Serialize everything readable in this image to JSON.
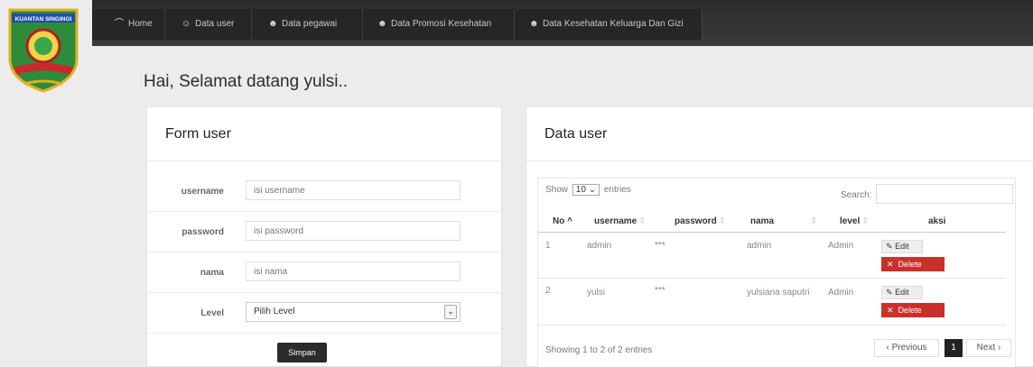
{
  "logo": {
    "text": "KUANTAN SINGINGI"
  },
  "nav": {
    "items": [
      {
        "icon": "dashboard-icon",
        "glyph": "⌒",
        "label": "Home"
      },
      {
        "icon": "user-icon",
        "glyph": "👤",
        "label": "Data user"
      },
      {
        "icon": "users-icon",
        "glyph": "👥",
        "label": "Data pegawai"
      },
      {
        "icon": "users-icon",
        "glyph": "👥",
        "label": "Data Promosi Kesehatan"
      },
      {
        "icon": "users-icon",
        "glyph": "👥",
        "label": "Data Kesehatan Keluarga Dan Gizi"
      }
    ]
  },
  "greeting": "Hai, Selamat datang yulsi..",
  "form": {
    "title": "Form user",
    "fields": [
      {
        "label": "username",
        "placeholder": "isi username"
      },
      {
        "label": "password",
        "placeholder": "isi password"
      },
      {
        "label": "nama",
        "placeholder": "isi nama"
      }
    ],
    "level_label": "Level",
    "level_selected": "Pilih Level",
    "submit": "Simpan"
  },
  "datatable": {
    "title": "Data user",
    "show": "Show",
    "length": "10",
    "entries": "entries",
    "search_label": "Search:",
    "headers": [
      "No",
      "username",
      "password",
      "nama",
      "level",
      "aksi"
    ],
    "rows": [
      {
        "no": "1",
        "username": "admin",
        "password": "***",
        "nama": "admin",
        "level": "Admin"
      },
      {
        "no": "2",
        "username": "yulsi",
        "password": "***",
        "nama": "yulsiana saputri",
        "level": "Admin"
      }
    ],
    "edit_label": "Edit",
    "delete_label": "Delete",
    "info": "Showing 1 to 2 of 2 entries",
    "prev": "‹ Previous",
    "page": "1",
    "next": "Next ›"
  },
  "colors": {
    "nav_bg": "#2b2b2b",
    "delete": "#c9302c",
    "accent_dark": "#222222"
  }
}
